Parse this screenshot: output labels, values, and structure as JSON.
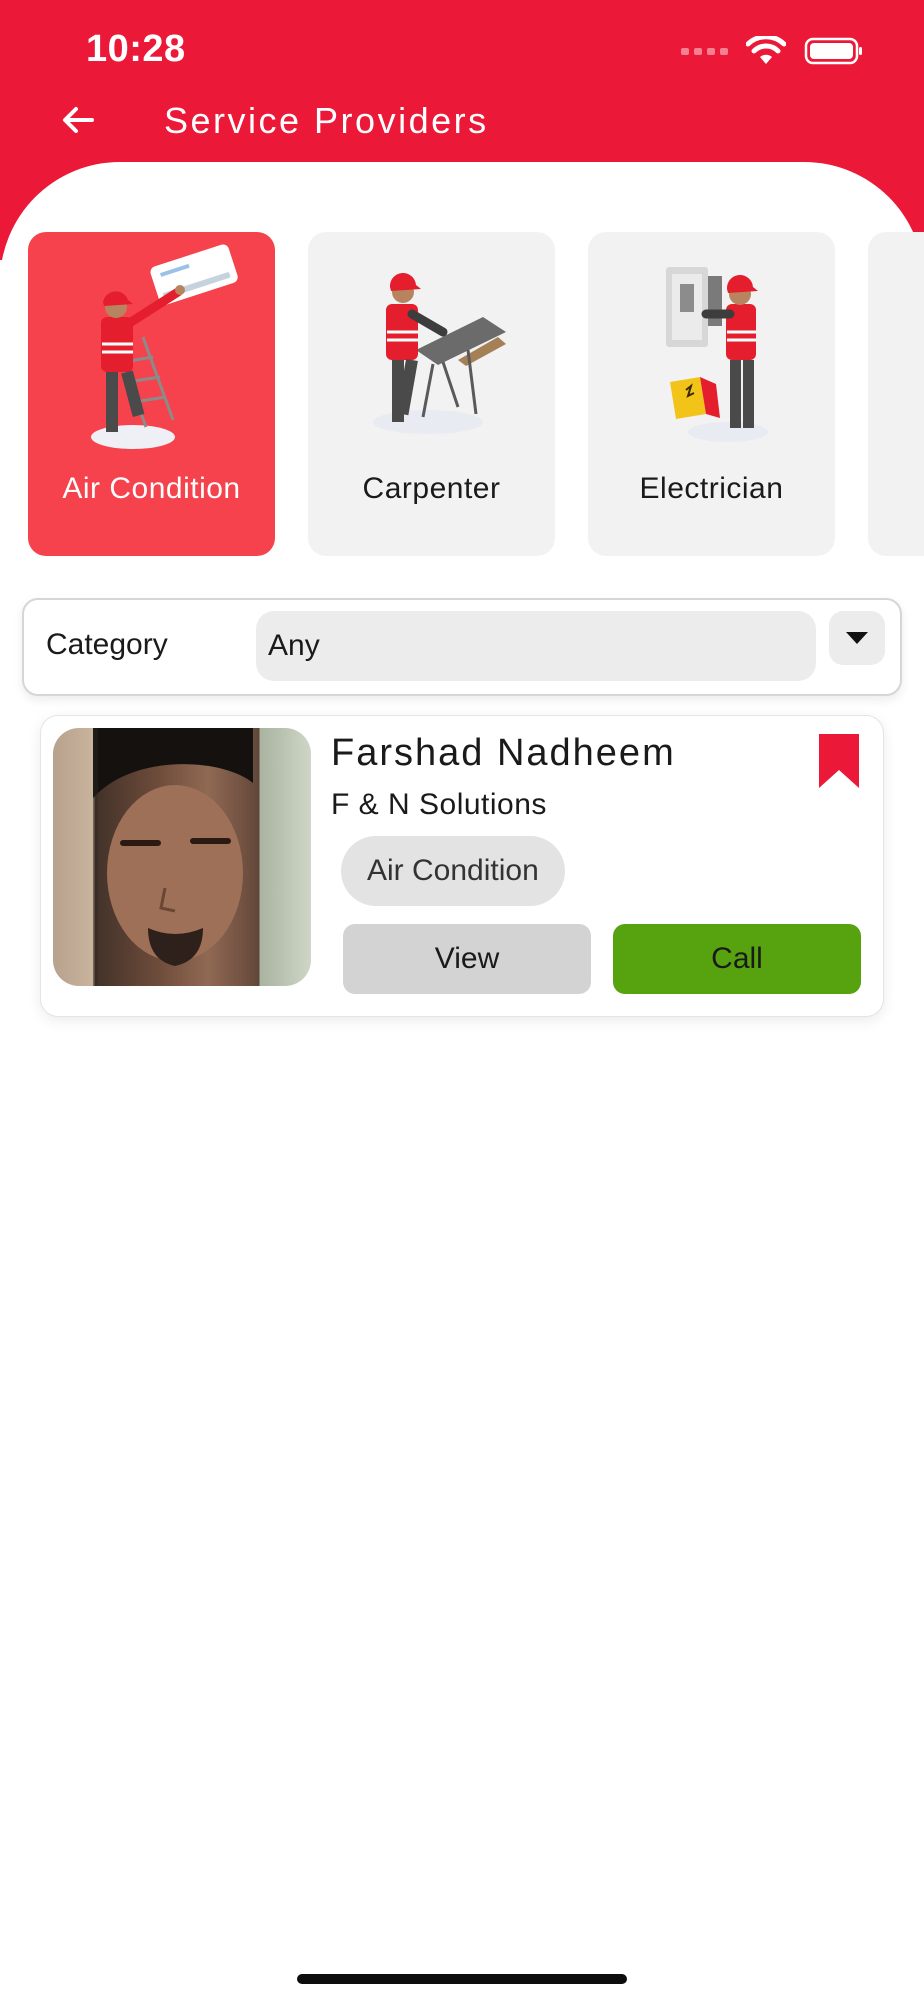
{
  "status_bar": {
    "time": "10:28"
  },
  "header": {
    "title": "Service Providers",
    "back_icon": "back-arrow-icon"
  },
  "colors": {
    "brand_red": "#ec1838",
    "active_card": "#f5424c",
    "call_green": "#57a20f",
    "bookmark": "#ec1838"
  },
  "categories": [
    {
      "label": "Air Condition",
      "active": true,
      "icon": "ac-technician-illustration"
    },
    {
      "label": "Carpenter",
      "active": false,
      "icon": "carpenter-illustration"
    },
    {
      "label": "Electrician",
      "active": false,
      "icon": "electrician-illustration"
    }
  ],
  "filter": {
    "label": "Category",
    "value": "Any",
    "dropdown_icon": "caret-down-icon"
  },
  "providers": [
    {
      "name": "Farshad Nadheem",
      "company": "F & N Solutions",
      "tag": "Air Condition",
      "view_label": "View",
      "call_label": "Call",
      "bookmarked": true
    }
  ]
}
